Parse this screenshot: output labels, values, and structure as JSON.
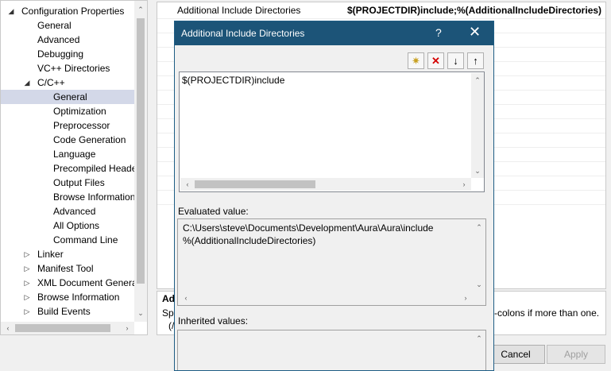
{
  "tree": {
    "items": [
      {
        "label": "Configuration Properties",
        "arrow": "◢",
        "level": 0
      },
      {
        "label": "General",
        "level": 1
      },
      {
        "label": "Advanced",
        "level": 1
      },
      {
        "label": "Debugging",
        "level": 1
      },
      {
        "label": "VC++ Directories",
        "level": 1
      },
      {
        "label": "C/C++",
        "arrow": "◢",
        "level": 1
      },
      {
        "label": "General",
        "level": 2,
        "selected": true
      },
      {
        "label": "Optimization",
        "level": 2
      },
      {
        "label": "Preprocessor",
        "level": 2
      },
      {
        "label": "Code Generation",
        "level": 2
      },
      {
        "label": "Language",
        "level": 2
      },
      {
        "label": "Precompiled Heade",
        "level": 2
      },
      {
        "label": "Output Files",
        "level": 2
      },
      {
        "label": "Browse Information",
        "level": 2
      },
      {
        "label": "Advanced",
        "level": 2
      },
      {
        "label": "All Options",
        "level": 2
      },
      {
        "label": "Command Line",
        "level": 2
      },
      {
        "label": "Linker",
        "arrow": "▷",
        "level": 1
      },
      {
        "label": "Manifest Tool",
        "arrow": "▷",
        "level": 1
      },
      {
        "label": "XML Document Genera",
        "arrow": "▷",
        "level": 1
      },
      {
        "label": "Browse Information",
        "arrow": "▷",
        "level": 1
      },
      {
        "label": "Build Events",
        "arrow": "▷",
        "level": 1
      }
    ]
  },
  "grid": {
    "property_name": "Additional Include Directories",
    "property_value": "$(PROJECTDIR)include;%(AdditionalIncludeDirectories)"
  },
  "description": {
    "title": "Add",
    "text": "Spe",
    "tail": "-colons if more than one.",
    "tail2": "(/"
  },
  "buttons": {
    "cancel": "Cancel",
    "apply": "Apply"
  },
  "dialog": {
    "title": "Additional Include Directories",
    "help": "?",
    "close": "✕",
    "toolbar": [
      {
        "name": "new-line-icon",
        "glyph": "✷"
      },
      {
        "name": "delete-icon",
        "glyph": "✕"
      },
      {
        "name": "move-down-icon",
        "glyph": "↓"
      },
      {
        "name": "move-up-icon",
        "glyph": "↑"
      }
    ],
    "edit_text": "$(PROJECTDIR)include",
    "evaluated_label": "Evaluated value:",
    "evaluated_lines": [
      "C:\\Users\\steve\\Documents\\Development\\Aura\\Aura\\include",
      "%(AdditionalIncludeDirectories)"
    ],
    "inherited_label": "Inherited values:"
  }
}
